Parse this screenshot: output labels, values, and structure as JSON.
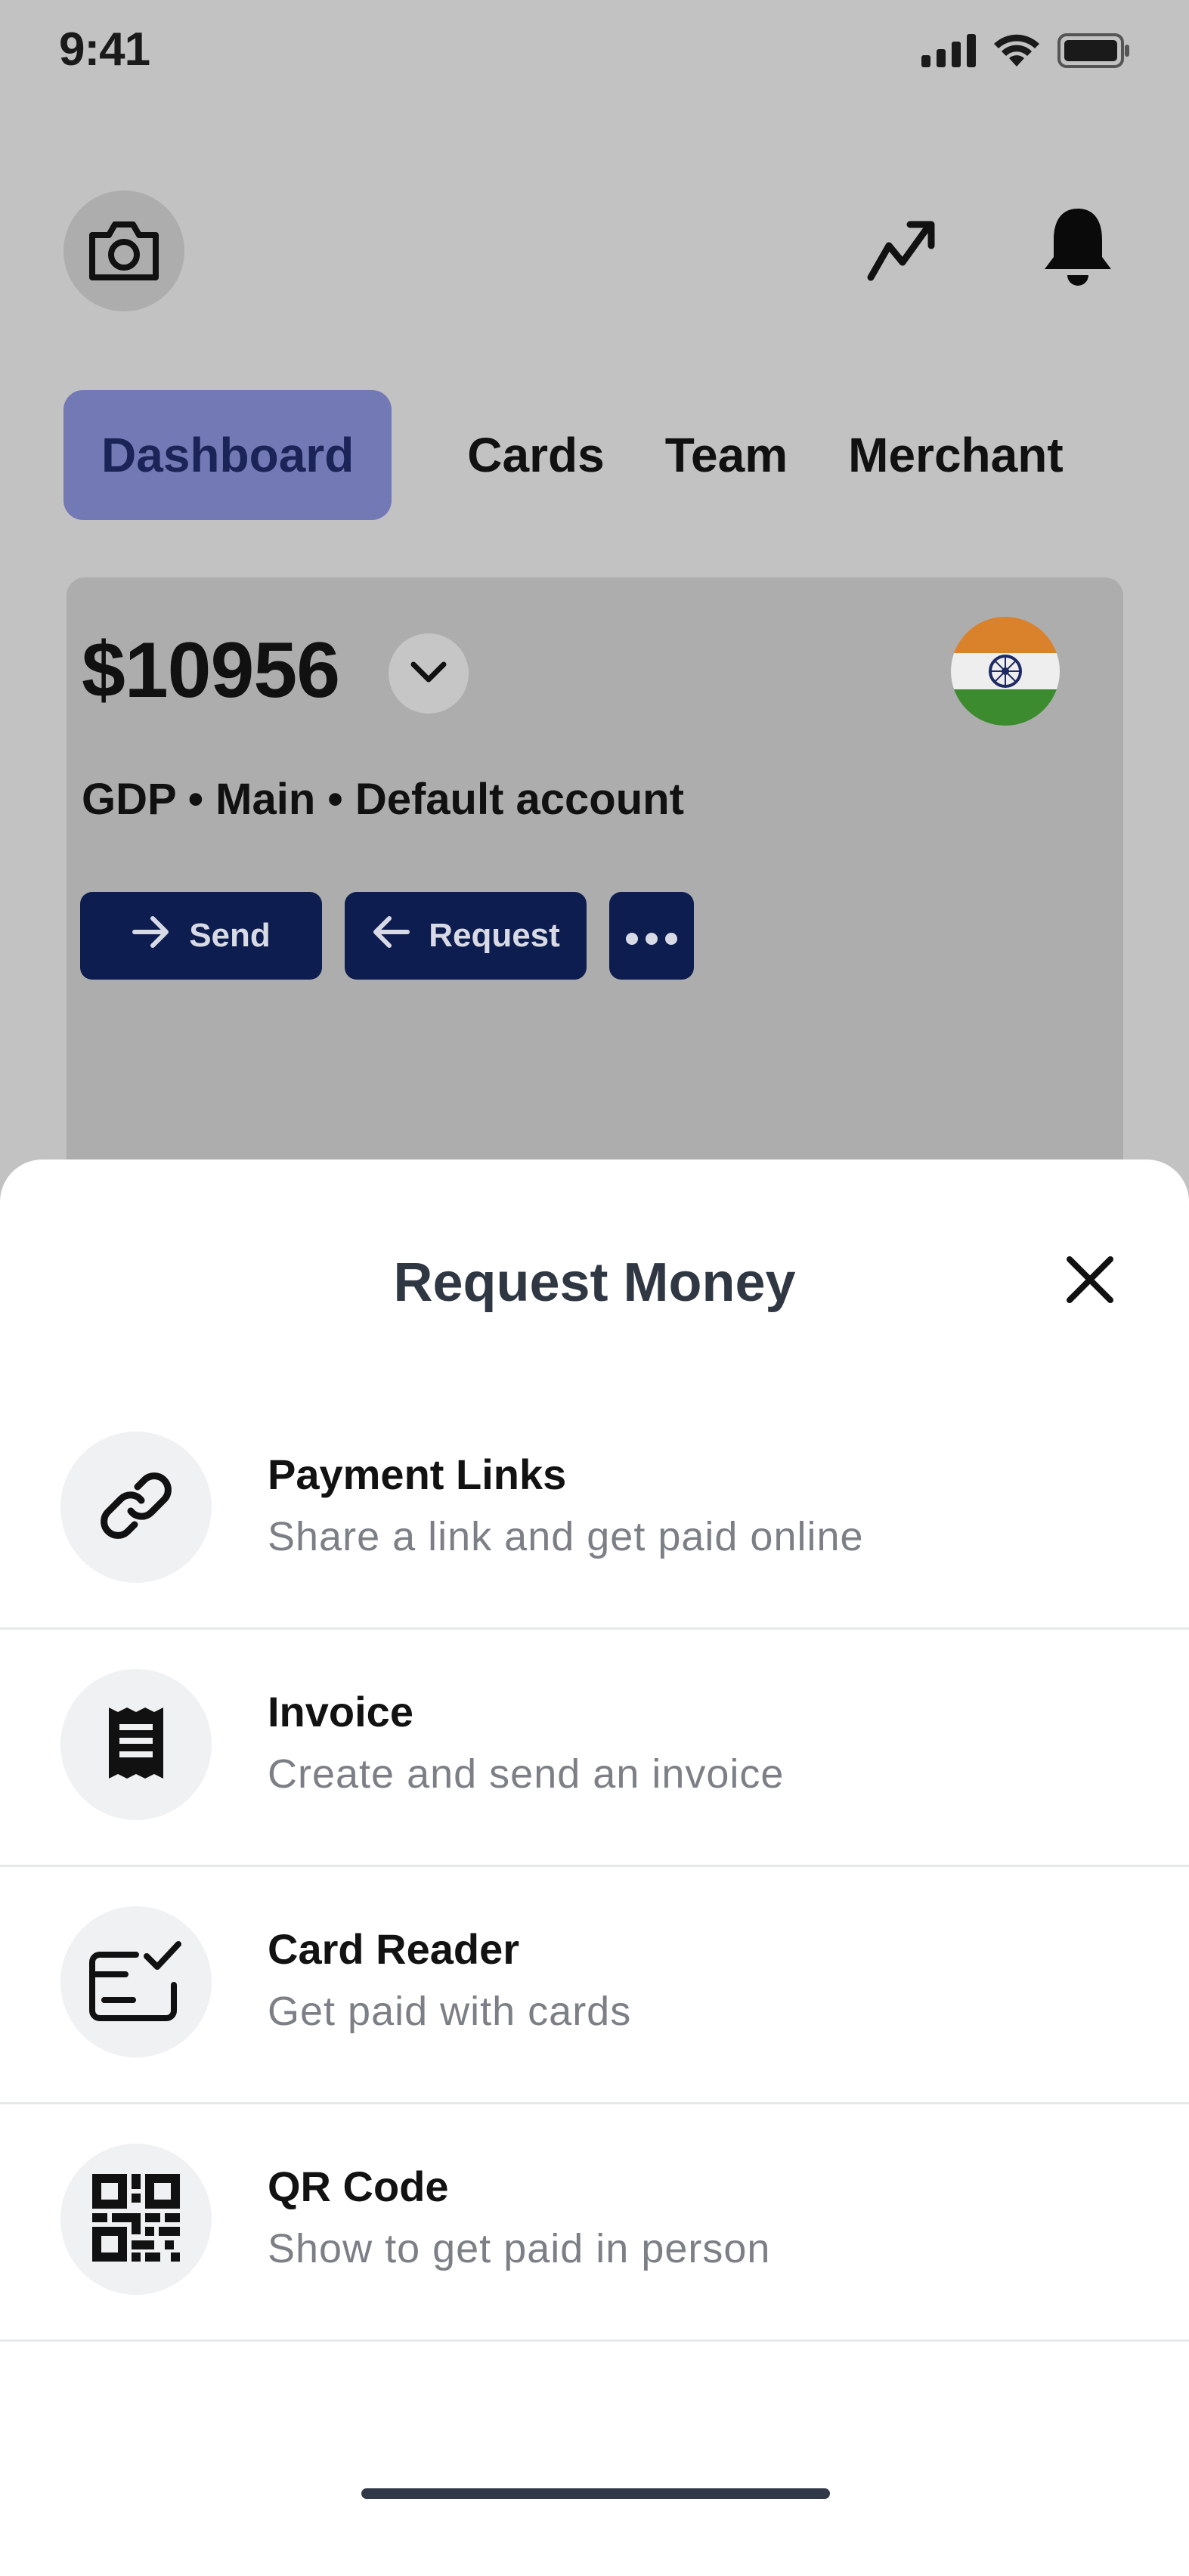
{
  "status_bar": {
    "time": "9:41",
    "icons": [
      "signal-icon",
      "wifi-icon",
      "battery-icon"
    ]
  },
  "header": {
    "left_icon": "camera-icon",
    "right_icons": [
      "trend-icon",
      "bell-icon"
    ]
  },
  "tabs": [
    {
      "label": "Dashboard",
      "active": true
    },
    {
      "label": "Cards",
      "active": false
    },
    {
      "label": "Team",
      "active": false
    },
    {
      "label": "Merchant",
      "active": false
    }
  ],
  "account": {
    "balance": "$10956",
    "details": "GDP • Main • Default account",
    "flag_icon": "india-flag-icon",
    "actions": {
      "send": "Send",
      "request": "Request"
    }
  },
  "sheet": {
    "title": "Request Money",
    "items": [
      {
        "title": "Payment Links",
        "subtitle": "Share a link and get paid online",
        "icon": "link-icon"
      },
      {
        "title": "Invoice",
        "subtitle": "Create and send an invoice",
        "icon": "receipt-icon"
      },
      {
        "title": "Card Reader",
        "subtitle": "Get paid with cards",
        "icon": "card-reader-icon"
      },
      {
        "title": "QR Code",
        "subtitle": "Show to get paid in person",
        "icon": "qr-code-icon"
      }
    ]
  },
  "colors": {
    "backdrop": "#c2c2c2",
    "active_tab_bg": "#7379b5",
    "active_tab_text": "#1b2457",
    "primary_button": "#0d1d4f",
    "sheet_bg": "#ffffff",
    "title_text": "#2f3743",
    "subtitle_text": "#7c7f85"
  }
}
